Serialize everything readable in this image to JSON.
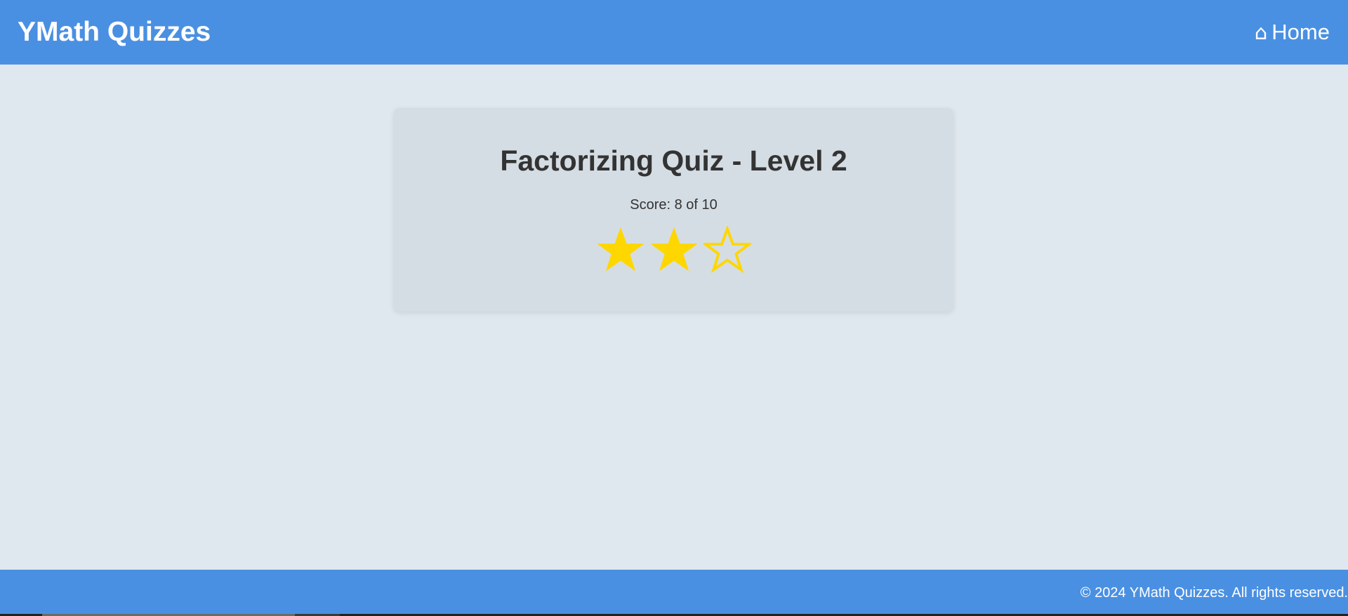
{
  "header": {
    "brand": "YMath Quizzes",
    "home_icon": "home-icon",
    "home_label": "Home"
  },
  "result": {
    "title": "Factorizing Quiz - Level 2",
    "score_text": "Score: 8 of 10",
    "stars_earned": 2,
    "stars_total": 3
  },
  "footer": {
    "copyright": "© 2024 YMath Quizzes. All rights reserved."
  },
  "colors": {
    "header_bg": "#4a90e2",
    "page_bg": "#e0e8ef",
    "card_bg": "#d5dde4",
    "star": "#ffd700",
    "text": "#333333"
  }
}
